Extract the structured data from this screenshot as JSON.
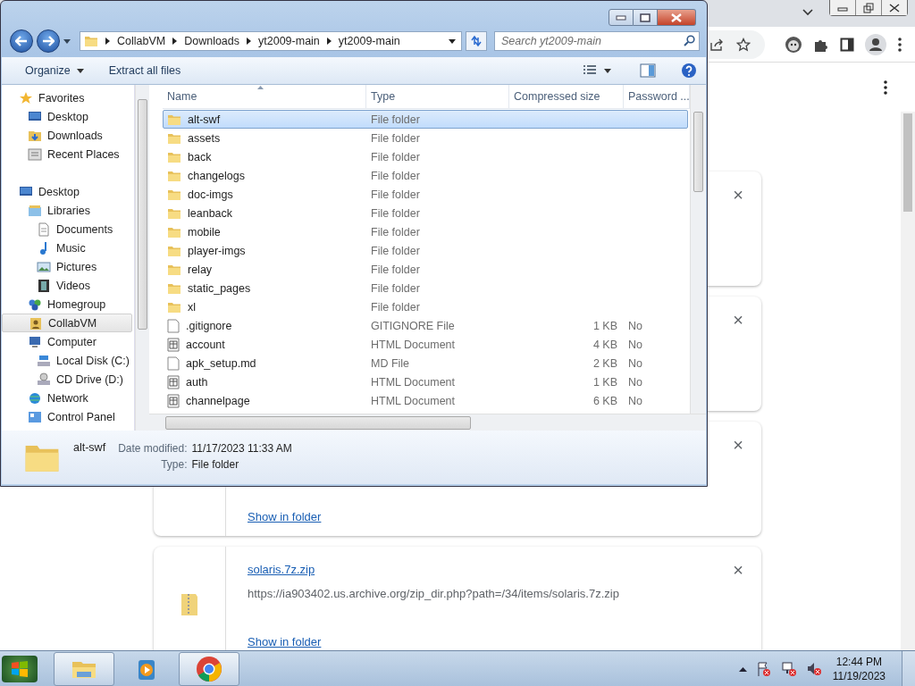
{
  "browser": {
    "downloads": [
      {
        "close": "×"
      },
      {
        "close": "×"
      },
      {
        "link": "Show in folder",
        "close": "×"
      },
      {
        "file_name": "solaris.7z.zip",
        "url": "https://ia903402.us.archive.org/zip_dir.php?path=/34/items/solaris.7z.zip",
        "link": "Show in folder",
        "close": "×"
      }
    ]
  },
  "explorer": {
    "breadcrumb": [
      "CollabVM",
      "Downloads",
      "yt2009-main",
      "yt2009-main"
    ],
    "search": {
      "placeholder": "Search yt2009-main"
    },
    "commands": [
      {
        "label": "Organize",
        "menu": true
      },
      {
        "label": "Extract all files",
        "menu": false
      }
    ],
    "navigation": [
      {
        "label": "Favorites",
        "kind": "star",
        "selected": false,
        "children": [
          {
            "label": "Desktop",
            "kind": "desktop",
            "selected": false
          },
          {
            "label": "Downloads",
            "kind": "downloads",
            "selected": false
          },
          {
            "label": "Recent Places",
            "kind": "recent",
            "selected": false
          }
        ]
      },
      {
        "label": "Desktop",
        "kind": "desktop",
        "selected": false,
        "children": [
          {
            "label": "Libraries",
            "kind": "library",
            "selected": false,
            "children": [
              {
                "label": "Documents",
                "kind": "document",
                "selected": false
              },
              {
                "label": "Music",
                "kind": "music",
                "selected": false
              },
              {
                "label": "Pictures",
                "kind": "picture",
                "selected": false
              },
              {
                "label": "Videos",
                "kind": "video",
                "selected": false
              }
            ]
          },
          {
            "label": "Homegroup",
            "kind": "homegroup",
            "selected": false
          },
          {
            "label": "CollabVM",
            "kind": "user",
            "selected": true
          },
          {
            "label": "Computer",
            "kind": "computer",
            "selected": false,
            "children": [
              {
                "label": "Local Disk (C:)",
                "kind": "disk",
                "selected": false
              },
              {
                "label": "CD Drive (D:)",
                "kind": "cd",
                "selected": false
              }
            ]
          },
          {
            "label": "Network",
            "kind": "network",
            "selected": false
          },
          {
            "label": "Control Panel",
            "kind": "panel",
            "selected": false
          }
        ]
      }
    ],
    "columns": [
      "Name",
      "Type",
      "Compressed size",
      "Password ..."
    ],
    "rows": [
      {
        "name": "alt-swf",
        "type": "File folder",
        "kind": "folder",
        "selected": true
      },
      {
        "name": "assets",
        "type": "File folder",
        "kind": "folder",
        "selected": false
      },
      {
        "name": "back",
        "type": "File folder",
        "kind": "folder",
        "selected": false
      },
      {
        "name": "changelogs",
        "type": "File folder",
        "kind": "folder",
        "selected": false
      },
      {
        "name": "doc-imgs",
        "type": "File folder",
        "kind": "folder",
        "selected": false
      },
      {
        "name": "leanback",
        "type": "File folder",
        "kind": "folder",
        "selected": false
      },
      {
        "name": "mobile",
        "type": "File folder",
        "kind": "folder",
        "selected": false
      },
      {
        "name": "player-imgs",
        "type": "File folder",
        "kind": "folder",
        "selected": false
      },
      {
        "name": "relay",
        "type": "File folder",
        "kind": "folder",
        "selected": false
      },
      {
        "name": "static_pages",
        "type": "File folder",
        "kind": "folder",
        "selected": false
      },
      {
        "name": "xl",
        "type": "File folder",
        "kind": "folder",
        "selected": false
      },
      {
        "name": ".gitignore",
        "type": "GITIGNORE File",
        "size": "1 KB",
        "password": "No",
        "kind": "file",
        "selected": false
      },
      {
        "name": "account",
        "type": "HTML Document",
        "size": "4 KB",
        "password": "No",
        "kind": "html",
        "selected": false
      },
      {
        "name": "apk_setup.md",
        "type": "MD File",
        "size": "2 KB",
        "password": "No",
        "kind": "file",
        "selected": false
      },
      {
        "name": "auth",
        "type": "HTML Document",
        "size": "1 KB",
        "password": "No",
        "kind": "html",
        "selected": false
      },
      {
        "name": "channelpage",
        "type": "HTML Document",
        "size": "6 KB",
        "password": "No",
        "kind": "html",
        "selected": false
      }
    ],
    "details": {
      "name": "alt-swf",
      "fields": [
        {
          "label": "Date modified:",
          "value": "11/17/2023 11:33 AM"
        },
        {
          "label": "Type:",
          "value": "File folder"
        }
      ]
    }
  },
  "taskbar": {
    "apps": [
      {
        "kind": "explorer",
        "running": true
      },
      {
        "kind": "media",
        "running": false
      },
      {
        "kind": "chrome",
        "running": true
      }
    ],
    "clock": {
      "time": "12:44 PM",
      "date": "11/19/2023"
    }
  }
}
